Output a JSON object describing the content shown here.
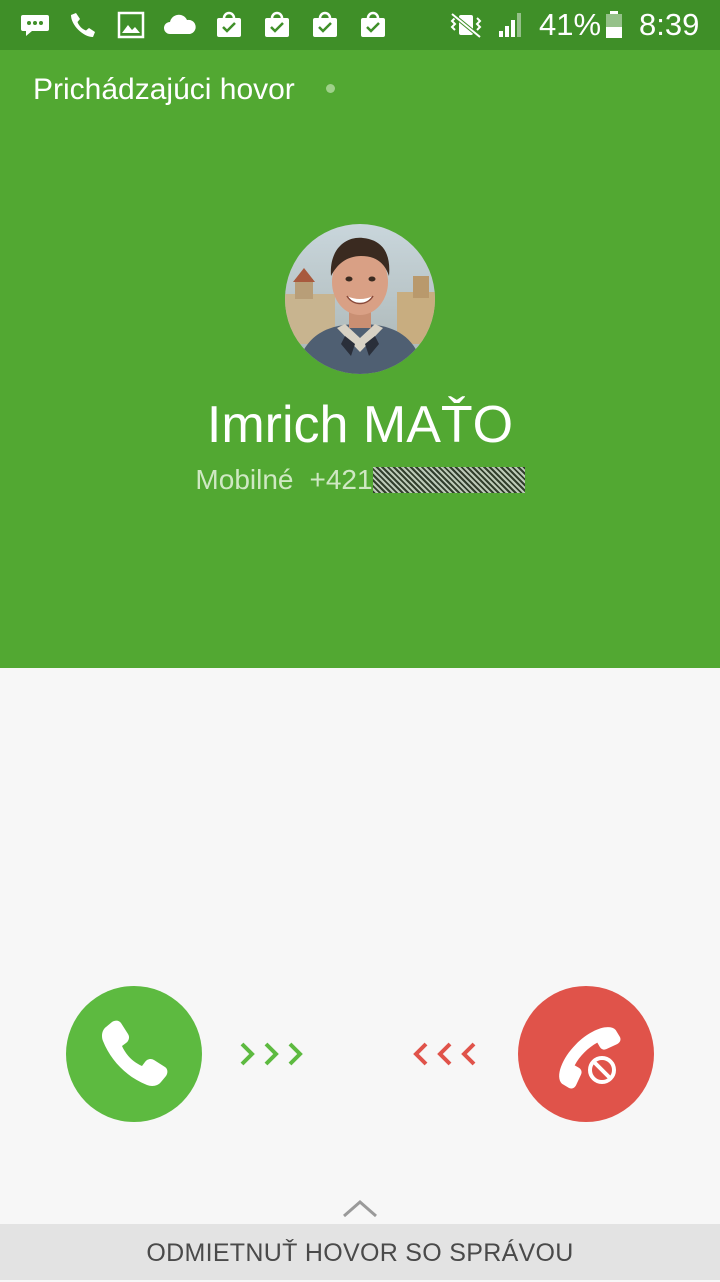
{
  "status_bar": {
    "notification_icons": [
      "messages-icon",
      "phone-icon",
      "gallery-icon",
      "cloud-icon",
      "store-bag-icon",
      "store-bag-icon",
      "store-bag-icon",
      "store-bag-icon"
    ],
    "battery_percent": "41%",
    "time": "8:39"
  },
  "call": {
    "status_label": "Prichádzajúci hovor",
    "caller_name": "Imrich MAŤO",
    "number_type": "Mobilné",
    "number_prefix": "+421"
  },
  "actions": {
    "answer_icon": "phone-icon",
    "reject_icon": "phone-reject-icon",
    "reject_with_message_label": "ODMIETNUŤ HOVOR SO SPRÁVOU"
  },
  "colors": {
    "status_bar": "#3f8f28",
    "header": "#52a832",
    "answer": "#5dba40",
    "reject": "#e0534a",
    "background": "#f7f7f7"
  }
}
